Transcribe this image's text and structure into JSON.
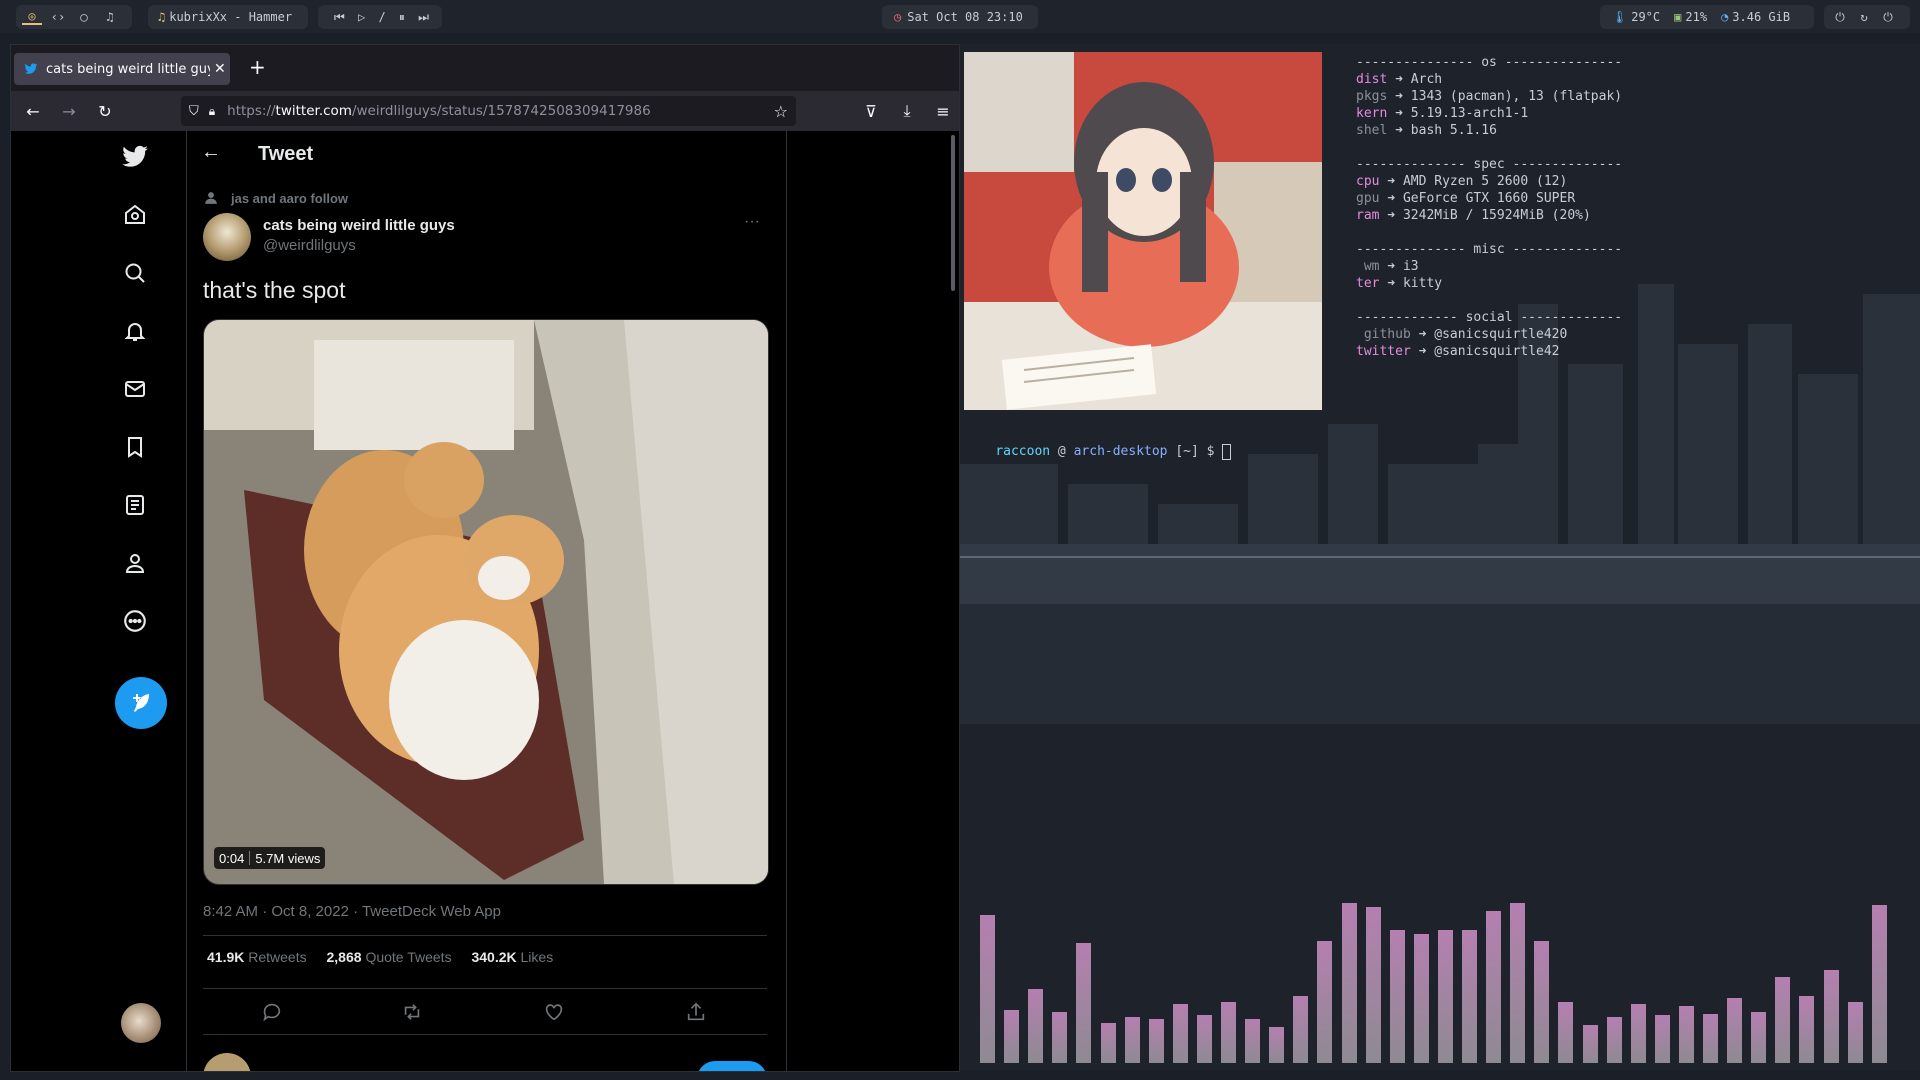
{
  "topbar": {
    "window_title": "kubrixXx - Hammer",
    "media_controls": "⏮ ▷ / ⏸ ⏭",
    "datetime": "Sat Oct 08 23:10",
    "temp": "29°C",
    "cpu": "21%",
    "mem": "3.46 GiB"
  },
  "browser": {
    "tab_title": "cats being weird little guys",
    "url_prefix": "https://",
    "url_domain": "twitter.com",
    "url_path": "/weirdlilguys/status/1578742508309417986"
  },
  "tweet": {
    "header": "Tweet",
    "social_context": "jas and aaro follow",
    "display_name": "cats being weird little guys",
    "handle": "@weirdlilguys",
    "text": "that's the spot",
    "video_time": "0:04",
    "video_views": "5.7M views",
    "timestamp": "8:42 AM · Oct 8, 2022 · TweetDeck Web App",
    "retweets": "41.9K",
    "retweets_label": "Retweets",
    "quotes": "2,868",
    "quotes_label": "Quote Tweets",
    "likes": "340.2K",
    "likes_label": "Likes"
  },
  "fetch": {
    "os_header": "--------------- os ---------------",
    "dist_k": "dist",
    "dist_v": "Arch",
    "pkgs_k": "pkgs",
    "pkgs_v": "1343 (pacman), 13 (flatpak)",
    "kern_k": "kern",
    "kern_v": "5.19.13-arch1-1",
    "shel_k": "shel",
    "shel_v": "bash 5.1.16",
    "spec_header": "-------------- spec --------------",
    "cpu_k": "cpu",
    "cpu_v": "AMD Ryzen 5 2600 (12)",
    "gpu_k": "gpu",
    "gpu_v": "GeForce GTX 1660 SUPER",
    "ram_k": "ram",
    "ram_v": "3242MiB / 15924MiB (20%)",
    "misc_header": "-------------- misc --------------",
    "wm_k": " wm",
    "wm_v": "i3",
    "ter_k": "ter",
    "ter_v": "kitty",
    "social_header": "------------- social -------------",
    "github_k": " github",
    "github_v": "@sanicsquirtle420",
    "twitter_k": "twitter",
    "twitter_v": "@sanicsquirtle42"
  },
  "prompt": {
    "user": "raccoon",
    "at": " @ ",
    "host": "arch-desktop",
    "dir": " [~] $ "
  },
  "visualizer": [
    0.78,
    0.28,
    0.39,
    0.27,
    0.63,
    0.21,
    0.24,
    0.23,
    0.31,
    0.25,
    0.32,
    0.23,
    0.19,
    0.35,
    0.64,
    0.84,
    0.82,
    0.7,
    0.68,
    0.7,
    0.7,
    0.8,
    0.84,
    0.64,
    0.32,
    0.2,
    0.24,
    0.31,
    0.25,
    0.3,
    0.26,
    0.34,
    0.27,
    0.45,
    0.35,
    0.49,
    0.32,
    0.83
  ],
  "colors": {
    "twitter_blue": "#1d9bf0",
    "terminal_user": "#5fd7ff",
    "terminal_host": "#87afff"
  }
}
